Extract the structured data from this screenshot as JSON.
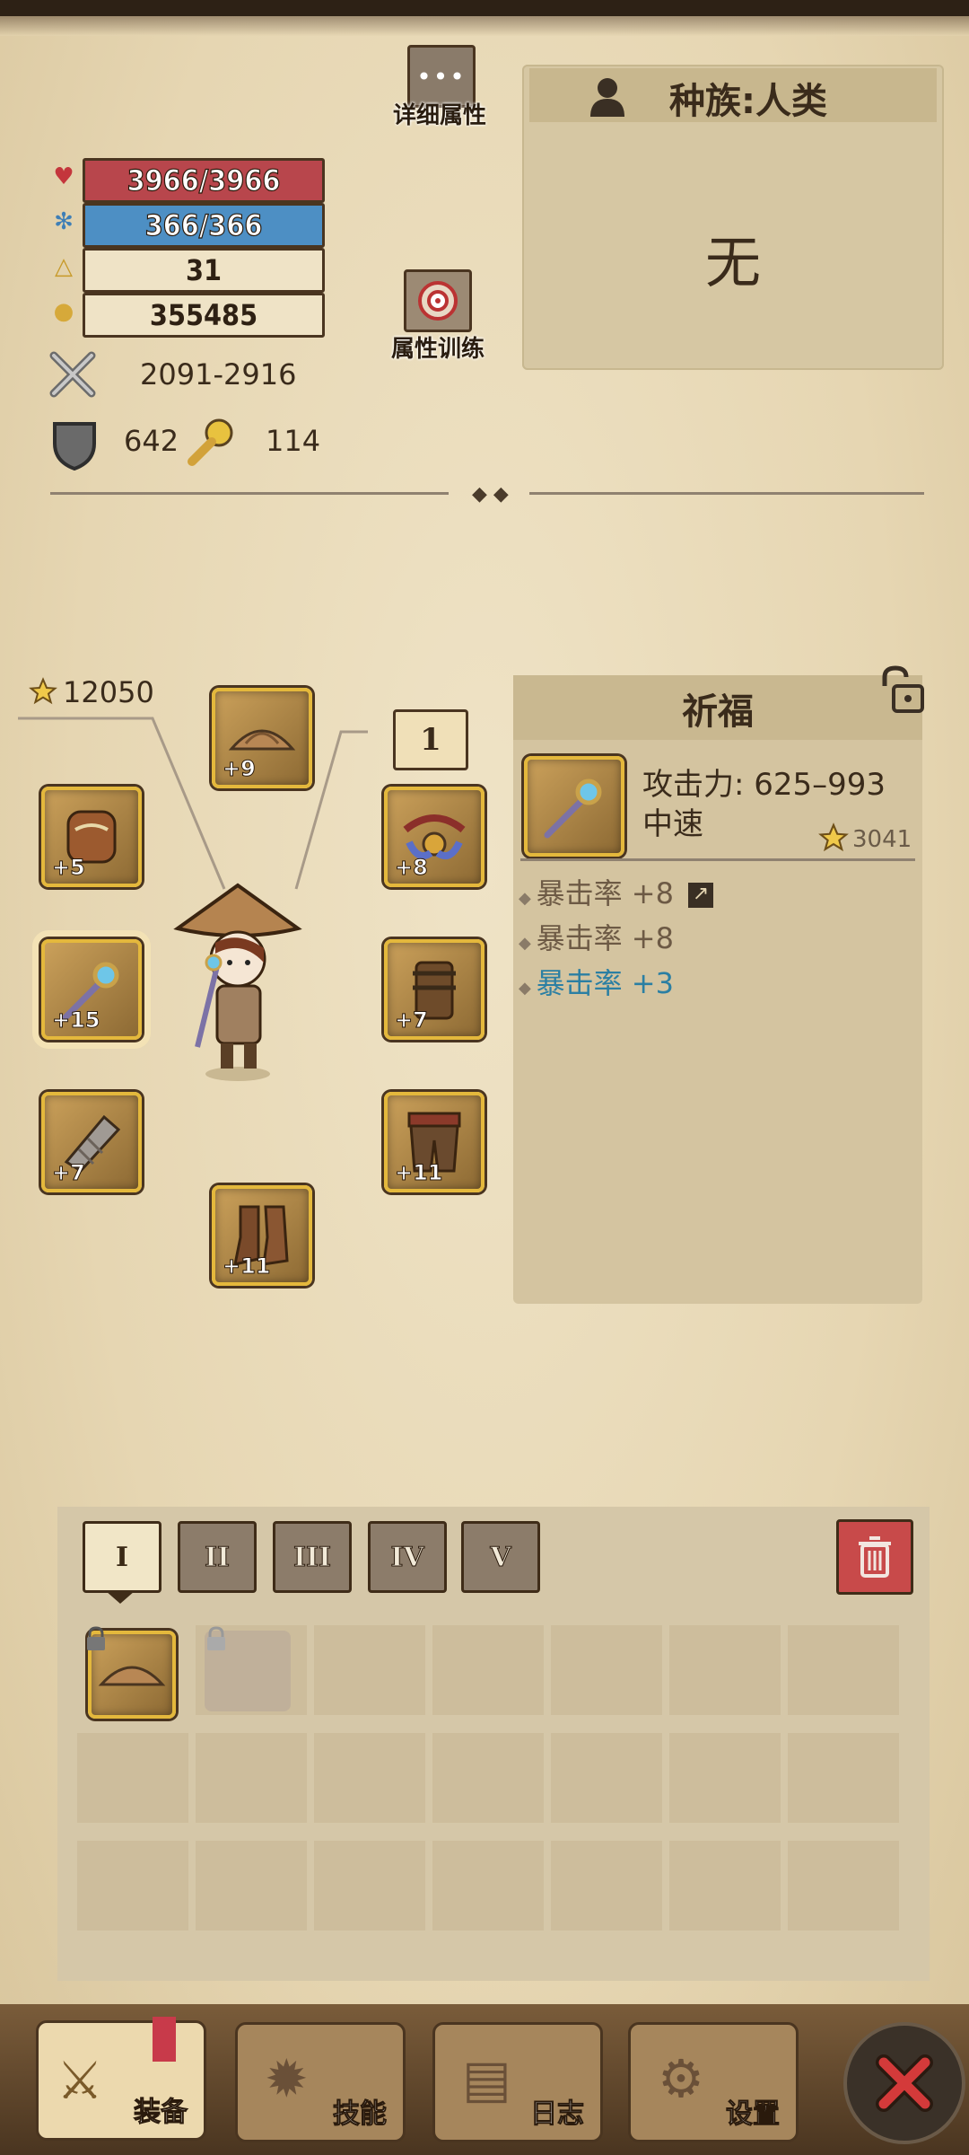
{
  "stats": {
    "hp": "3966/3966",
    "mp": "366/366",
    "level": "31",
    "gold": "355485",
    "attack": "2091-2916",
    "armor": "642",
    "luck": "114"
  },
  "buttons": {
    "detail": "详细属性",
    "training": "属性训练"
  },
  "race": {
    "label": "种族:人类",
    "value": "无"
  },
  "equipment": {
    "score": "12050",
    "marker": "1",
    "slots": [
      {
        "name": "hat-slot",
        "level": "+9"
      },
      {
        "name": "armor-slot",
        "level": "+5"
      },
      {
        "name": "amulet-slot",
        "level": "+8"
      },
      {
        "name": "weapon-slot",
        "level": "+15"
      },
      {
        "name": "bracelet-slot",
        "level": "+7"
      },
      {
        "name": "glove-slot",
        "level": "+7"
      },
      {
        "name": "pants-slot",
        "level": "+11"
      },
      {
        "name": "boots-slot",
        "level": "+11"
      }
    ]
  },
  "item_info": {
    "title": "祈福",
    "attack": "攻击力: 625–993",
    "speed": "中速",
    "score": "3041",
    "affixes": [
      {
        "text": "暴击率 +8",
        "color": "#6d5a45"
      },
      {
        "text": "暴击率 +8",
        "color": "#6d5a45"
      },
      {
        "text": "暴击率 +3",
        "color": "#2b7fa3"
      }
    ]
  },
  "tiers": [
    "I",
    "II",
    "III",
    "IV",
    "V"
  ],
  "nav": [
    "装备",
    "技能",
    "日志",
    "设置"
  ],
  "colors": {
    "accent": "#e4b83c",
    "hp": "#b8464c",
    "mp": "#4d8fc4",
    "close": "#d43a3a"
  }
}
